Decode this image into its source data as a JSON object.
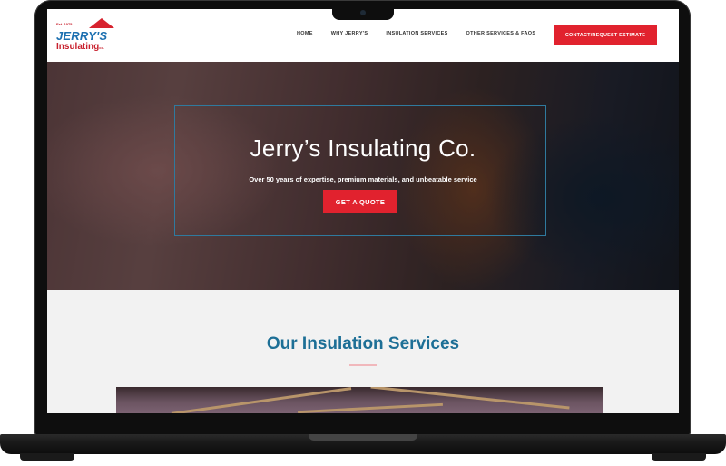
{
  "logo": {
    "est": "Est. 1975",
    "name": "JERRY'S",
    "sub": "Insulating",
    "co": "co."
  },
  "nav": {
    "items": [
      "HOME",
      "WHY JERRY'S",
      "INSULATION SERVICES",
      "OTHER SERVICES & FAQS"
    ],
    "cta": "CONTACT/REQUEST ESTIMATE"
  },
  "hero": {
    "title": "Jerry’s Insulating Co.",
    "subtitle": "Over 50 years of expertise, premium materials, and unbeatable service",
    "button": "GET A QUOTE"
  },
  "services": {
    "title": "Our Insulation Services"
  },
  "colors": {
    "brand_red": "#e1222e",
    "brand_blue": "#1d6f96",
    "logo_blue": "#1b6fb0"
  }
}
